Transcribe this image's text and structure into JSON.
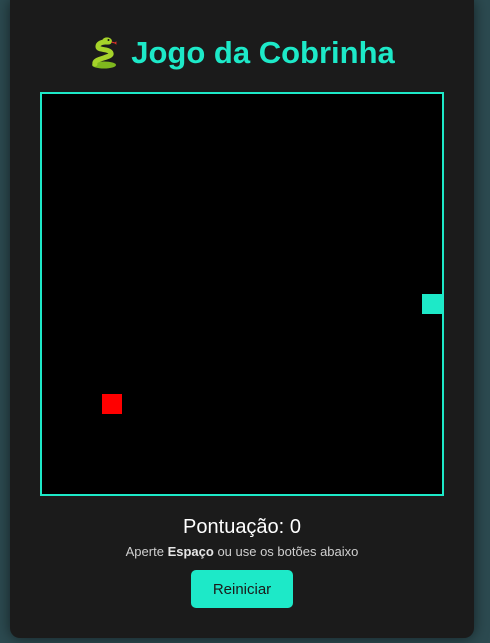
{
  "header": {
    "title": "Jogo da Cobrinha",
    "icon": "snake-icon"
  },
  "game": {
    "grid_size": 20,
    "snake": [
      {
        "col": 19,
        "row": 10
      }
    ],
    "food": {
      "col": 3,
      "row": 15
    },
    "snake_color": "#1de9c8",
    "food_color": "#ff0000"
  },
  "status": {
    "score_label": "Pontuação:",
    "score_value": "0",
    "hint_before": "Aperte",
    "hint_key": "Espaço",
    "hint_after": "ou use os botões abaixo"
  },
  "controls": {
    "restart_label": "Reiniciar"
  },
  "colors": {
    "accent": "#1de9c8",
    "card_bg": "#1b1b1b",
    "page_bg": "#2c4a50"
  }
}
